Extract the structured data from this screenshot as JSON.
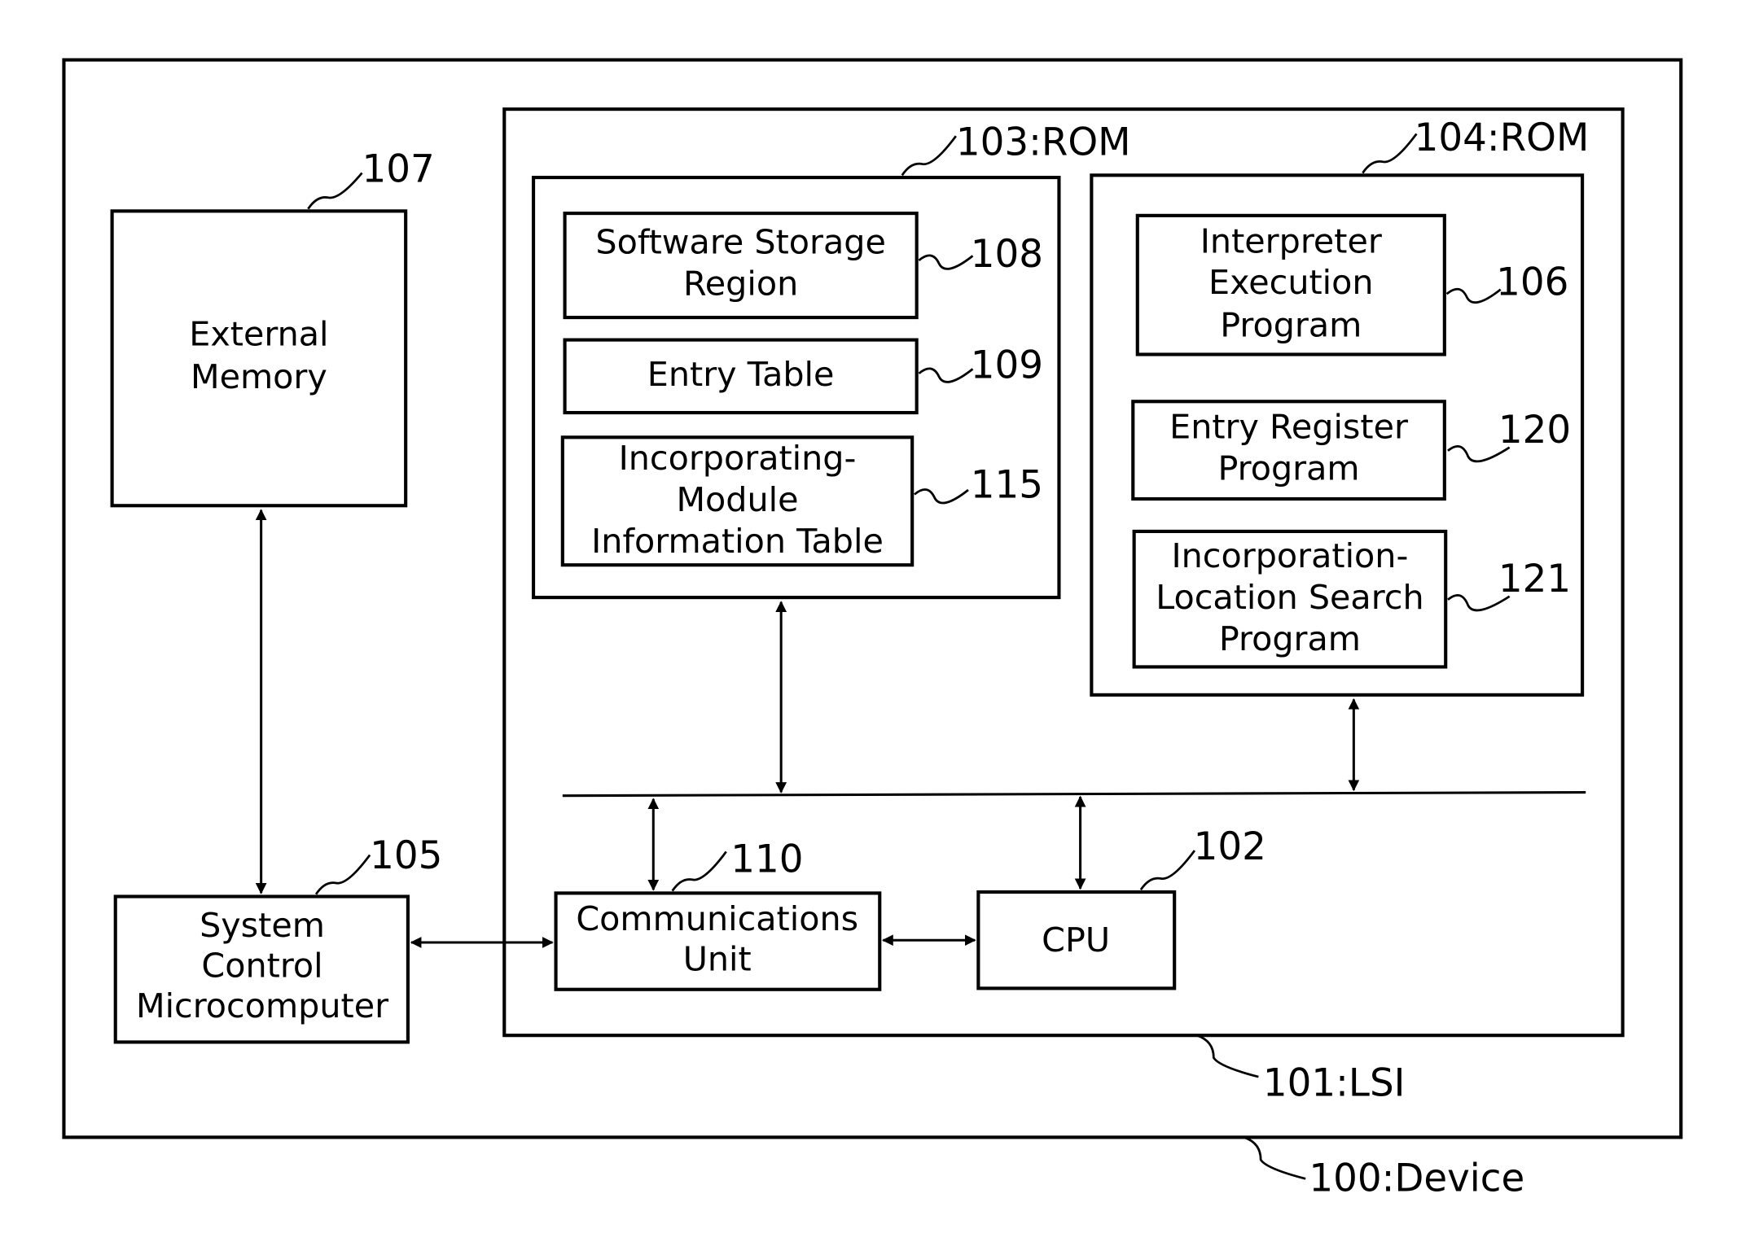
{
  "diagram": {
    "device": {
      "ref": "100:Device"
    },
    "lsi": {
      "ref": "101:LSI"
    },
    "rom103": {
      "ref": "103:ROM"
    },
    "rom104": {
      "ref": "104:ROM"
    },
    "external_memory": {
      "ref": "107",
      "lines": [
        "External",
        "Memory"
      ]
    },
    "system_control": {
      "ref": "105",
      "lines": [
        "System",
        "Control",
        "Microcomputer"
      ]
    },
    "comm_unit": {
      "ref": "110",
      "lines": [
        "Communications",
        "Unit"
      ]
    },
    "cpu": {
      "ref": "102",
      "lines": [
        "CPU"
      ]
    },
    "software_storage": {
      "ref": "108",
      "lines": [
        "Software Storage",
        "Region"
      ]
    },
    "entry_table": {
      "ref": "109",
      "lines": [
        "Entry Table"
      ]
    },
    "incorporating_module": {
      "ref": "115",
      "lines": [
        "Incorporating-",
        "Module",
        "Information Table"
      ]
    },
    "interpreter": {
      "ref": "106",
      "lines": [
        "Interpreter",
        "Execution",
        "Program"
      ]
    },
    "entry_register": {
      "ref": "120",
      "lines": [
        "Entry Register",
        "Program"
      ]
    },
    "incorporation_location": {
      "ref": "121",
      "lines": [
        "Incorporation-",
        "Location Search",
        "Program"
      ]
    }
  }
}
